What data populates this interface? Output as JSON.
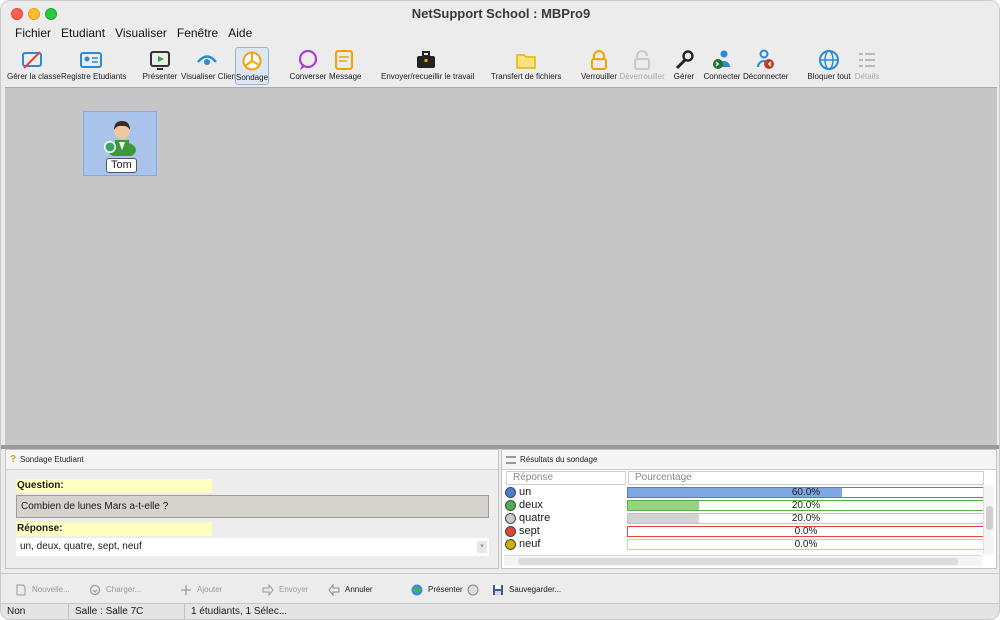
{
  "window": {
    "title": "NetSupport School : MBPro9"
  },
  "menu": [
    "Fichier",
    "Etudiant",
    "Visualiser",
    "Fenêtre",
    "Aide"
  ],
  "toolbar": {
    "manage_class": "Gérer la classe",
    "student_register": "Registre Etudiants",
    "present": "Présenter",
    "view_client": "Visualiser Client",
    "survey": "Sondage",
    "chat": "Converser",
    "message": "Message",
    "send_collect": "Envoyer/recueillir le travail",
    "file_transfer": "Transfert de fichiers",
    "lock": "Verrouiller",
    "unlock": "Déverrouiller",
    "manage": "Gérer",
    "connect": "Connecter",
    "disconnect": "Déconnecter",
    "block_all": "Bloquer tout",
    "details": "Détails"
  },
  "student": {
    "name": "Tom"
  },
  "poll_panel": {
    "title": "Sondage Etudiant",
    "question_label": "Question:",
    "question": "Combien de lunes Mars a-t-elle ?",
    "answer_label": "Réponse:",
    "answers": "un, deux, quatre, sept, neuf"
  },
  "results_panel": {
    "title": "Résultats du sondage",
    "col_answer": "Réponse",
    "col_percent": "Pourcentage",
    "rows": [
      {
        "name": "un",
        "percent_text": "60.0%",
        "percent": 60.0,
        "dot": "#4a7fd0",
        "fill": "#7ea8e4",
        "border": "#4a7fd0"
      },
      {
        "name": "deux",
        "percent_text": "20.0%",
        "percent": 20.0,
        "dot": "#4caf50",
        "fill": "#93d67e",
        "border": "#52b043"
      },
      {
        "name": "quatre",
        "percent_text": "20.0%",
        "percent": 20.0,
        "dot": "#c9c9c9",
        "fill": "#d4d4d4",
        "border": "#c4c4c4"
      },
      {
        "name": "sept",
        "percent_text": "0.0%",
        "percent": 0.0,
        "dot": "#e0463c",
        "fill": "#f29b94",
        "border": "#e0463c"
      },
      {
        "name": "neuf",
        "percent_text": "0.0%",
        "percent": 0.0,
        "dot": "#c9b300",
        "fill": "#efe39a",
        "border": "#e6d35c"
      }
    ]
  },
  "actions": {
    "new": "Nouvelle...",
    "load": "Charger...",
    "add": "Ajouter",
    "send": "Envoyer",
    "cancel": "Annuler",
    "present": "Présenter",
    "save": "Sauvegarder..."
  },
  "status": {
    "availability": "Non disponi...",
    "room": "Salle : Salle 7C",
    "selection": "1 étudiants, 1 Sélec..."
  },
  "colors": {
    "accent": "#2a8bd4",
    "selection": "#a9c3ea",
    "canvas": "#c6c6c6"
  }
}
